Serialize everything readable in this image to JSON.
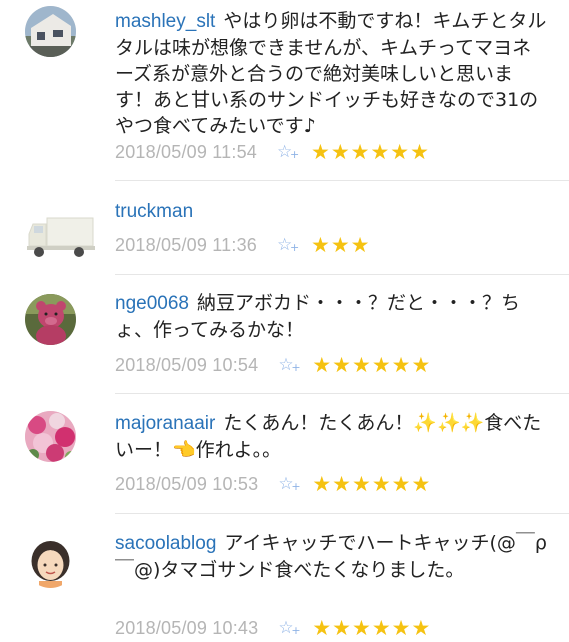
{
  "comments": [
    {
      "username": "mashley_slt",
      "text": "やはり卵は不動ですね！キムチとタルタルは味が想像できませんが、キムチってマヨネーズ系が意外と合うので絶対美味しいと思います！あと甘い系のサンドイッチも好きなので31のやつ食べてみたいです♪",
      "timestamp": "2018/05/09 11:54",
      "stars": "★★★★★★",
      "avatar": "house-photo"
    },
    {
      "username": "truckman",
      "text": "",
      "timestamp": "2018/05/09 11:36",
      "stars": "★★★",
      "avatar": "truck-icon"
    },
    {
      "username": "nge0068",
      "text": "納豆アボカド・・・？だと・・・？ちょ、作ってみるかな！",
      "timestamp": "2018/05/09 10:54",
      "stars": "★★★★★★",
      "avatar": "pink-bear-photo"
    },
    {
      "username": "majoranaair",
      "text": "たくあん！たくあん！✨✨✨食べたいー！👈作れよ。。",
      "timestamp": "2018/05/09 10:53",
      "stars": "★★★★★★",
      "avatar": "pink-flowers-photo"
    },
    {
      "username": "sacoolablog",
      "text": "アイキャッチでハートキャッチ(@￣ρ￣@)タマゴサンド食べたくなりました。",
      "timestamp": "2018/05/09 10:43",
      "stars": "★★★★★★",
      "avatar": "woman-illustration"
    }
  ],
  "colors": {
    "username": "#2a73b8",
    "timestamp": "#b5b5b5",
    "star": "#f5c211",
    "add_star": "#8fb3e6"
  }
}
